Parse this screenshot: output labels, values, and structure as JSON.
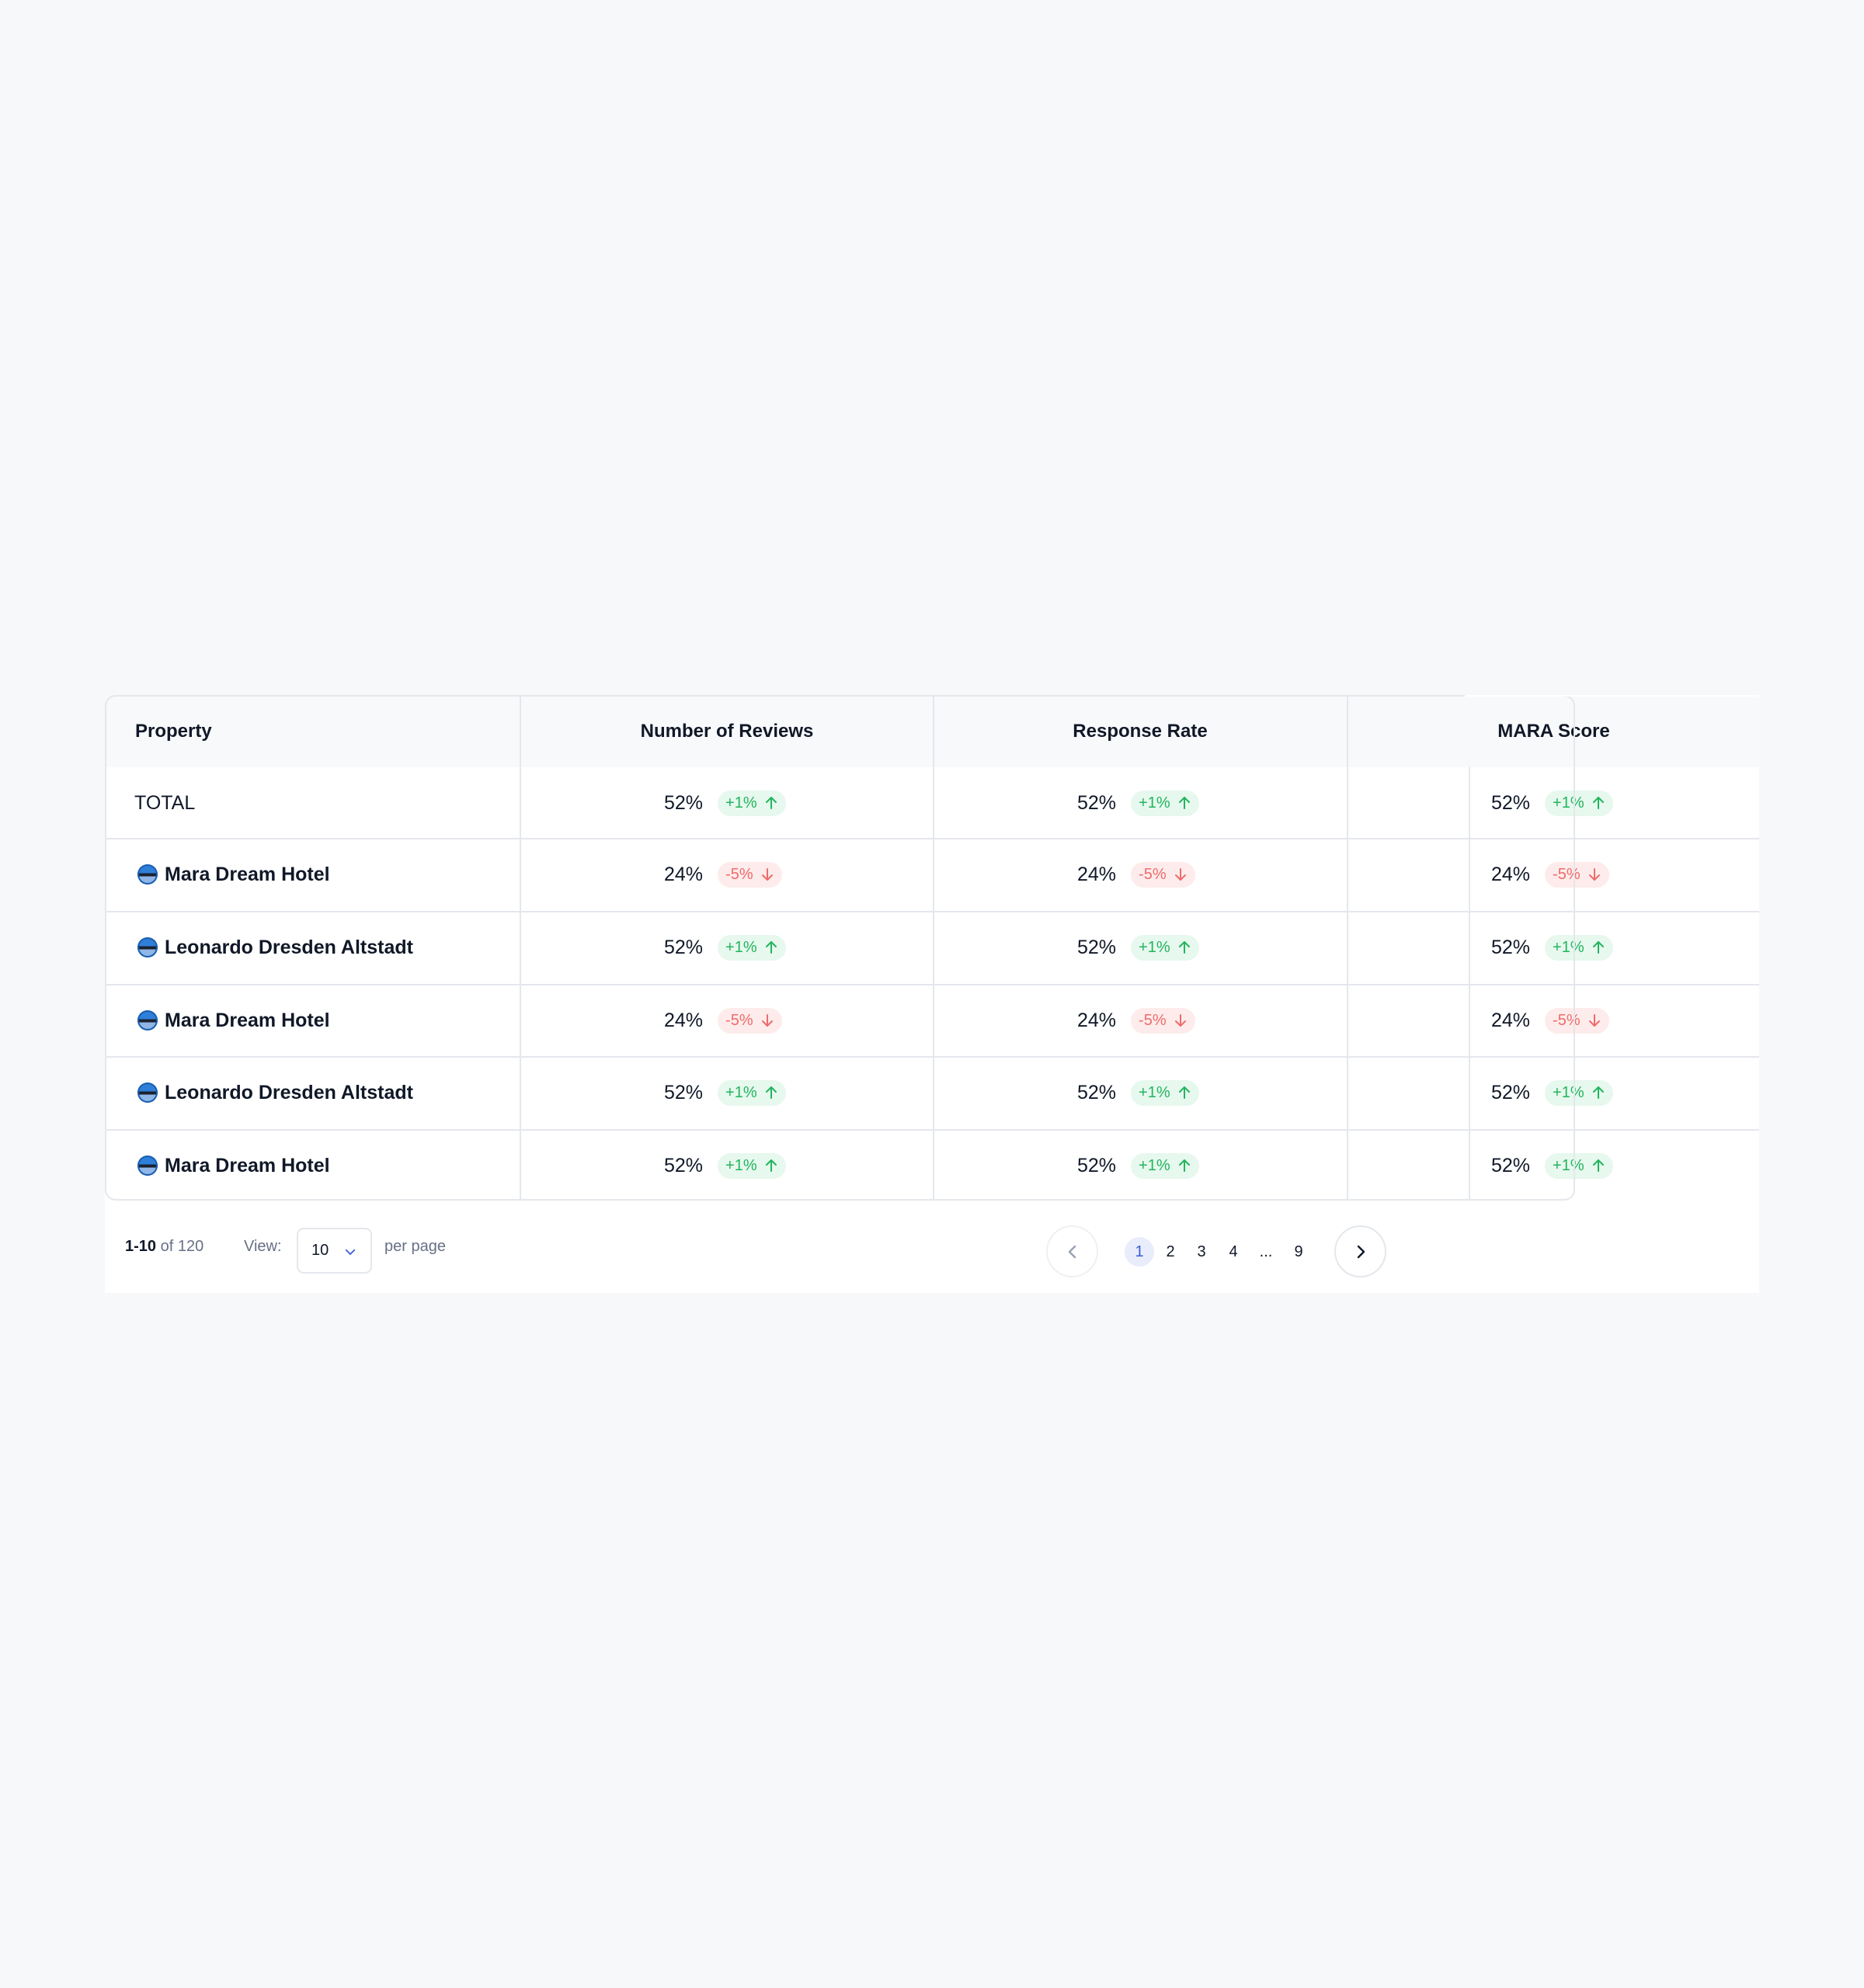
{
  "table": {
    "headers": [
      "Property",
      "Number of Reviews",
      "Response Rate",
      "MARA Score"
    ],
    "rows": [
      {
        "property": "TOTAL",
        "is_total": true,
        "metrics": [
          {
            "value": "52%",
            "change": "+1%",
            "trend": "up"
          },
          {
            "value": "52%",
            "change": "+1%",
            "trend": "up"
          },
          {
            "value": "52%",
            "change": "+1%",
            "trend": "up"
          }
        ]
      },
      {
        "property": "Mara Dream Hotel",
        "is_total": false,
        "metrics": [
          {
            "value": "24%",
            "change": "-5%",
            "trend": "down"
          },
          {
            "value": "24%",
            "change": "-5%",
            "trend": "down"
          },
          {
            "value": "24%",
            "change": "-5%",
            "trend": "down"
          }
        ]
      },
      {
        "property": "Leonardo Dresden Altstadt",
        "is_total": false,
        "metrics": [
          {
            "value": "52%",
            "change": "+1%",
            "trend": "up"
          },
          {
            "value": "52%",
            "change": "+1%",
            "trend": "up"
          },
          {
            "value": "52%",
            "change": "+1%",
            "trend": "up"
          }
        ]
      },
      {
        "property": "Mara Dream Hotel",
        "is_total": false,
        "metrics": [
          {
            "value": "24%",
            "change": "-5%",
            "trend": "down"
          },
          {
            "value": "24%",
            "change": "-5%",
            "trend": "down"
          },
          {
            "value": "24%",
            "change": "-5%",
            "trend": "down"
          }
        ]
      },
      {
        "property": "Leonardo Dresden Altstadt",
        "is_total": false,
        "metrics": [
          {
            "value": "52%",
            "change": "+1%",
            "trend": "up"
          },
          {
            "value": "52%",
            "change": "+1%",
            "trend": "up"
          },
          {
            "value": "52%",
            "change": "+1%",
            "trend": "up"
          }
        ]
      },
      {
        "property": "Mara Dream Hotel",
        "is_total": false,
        "metrics": [
          {
            "value": "52%",
            "change": "+1%",
            "trend": "up"
          },
          {
            "value": "52%",
            "change": "+1%",
            "trend": "up"
          },
          {
            "value": "52%",
            "change": "+1%",
            "trend": "up"
          }
        ]
      }
    ]
  },
  "pagination": {
    "range": "1-10",
    "total_text": "of 120",
    "view_label": "View:",
    "per_page_value": "10",
    "per_page_label": "per page",
    "pages": [
      "1",
      "2",
      "3",
      "4",
      "...",
      "9"
    ],
    "active_page": "1",
    "icons": {
      "prev": "chevron-left-icon",
      "next": "chevron-right-icon",
      "select": "chevron-down-icon"
    }
  },
  "colors": {
    "positive": "#22b55e",
    "positive_bg": "#e7f8ee",
    "negative": "#ef6b6b",
    "negative_bg": "#fdeceb",
    "active_page": "#3b5bdb"
  }
}
